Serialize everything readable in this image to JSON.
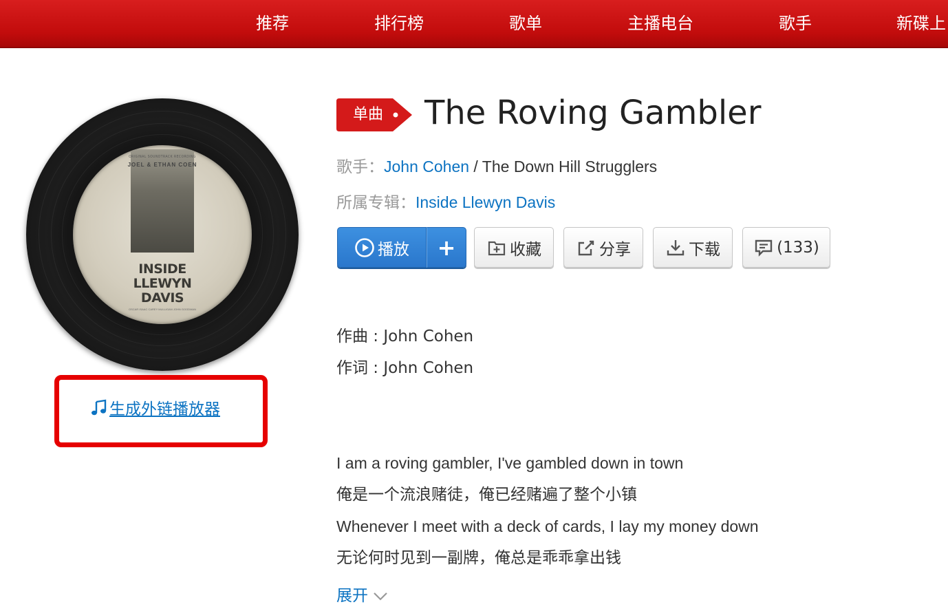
{
  "nav": {
    "items": [
      "推荐",
      "排行榜",
      "歌单",
      "主播电台",
      "歌手",
      "新碟上"
    ]
  },
  "cover": {
    "topline": "ORIGINAL SOUNDTRACK RECORDING",
    "directors": "JOEL & ETHAN COEN",
    "title_lines": [
      "INSIDE",
      "LLEWYN",
      "DAVIS"
    ],
    "credits": "OSCAR ISAAC   CAREY MULLIGAN   JOHN GOODMAN"
  },
  "embed": {
    "label": "生成外链播放器"
  },
  "song": {
    "tag": "单曲",
    "title": "The Roving Gambler",
    "artist_label": "歌手：",
    "artist_primary": "John Cohen",
    "artist_rest": " / The Down Hill Strugglers",
    "album_label": "所属专辑：",
    "album": "Inside Llewyn Davis"
  },
  "buttons": {
    "play": "播放",
    "add": "+",
    "collect": "收藏",
    "share": "分享",
    "download": "下载",
    "comment": "(133)"
  },
  "lyrics": {
    "composer": "作曲 : John Cohen",
    "lyricist": "作词 : John Cohen",
    "lines": [
      "I am a roving gambler, I've gambled down in town",
      "俺是一个流浪赌徒，俺已经赌遍了整个小镇",
      "Whenever I meet with a deck of cards, I lay my money down",
      "无论何时见到一副牌，俺总是乖乖拿出钱"
    ],
    "expand": "展开"
  },
  "colors": {
    "nav_red": "#c20c0c",
    "link_blue": "#0c73c2",
    "highlight_red": "#e60000"
  }
}
